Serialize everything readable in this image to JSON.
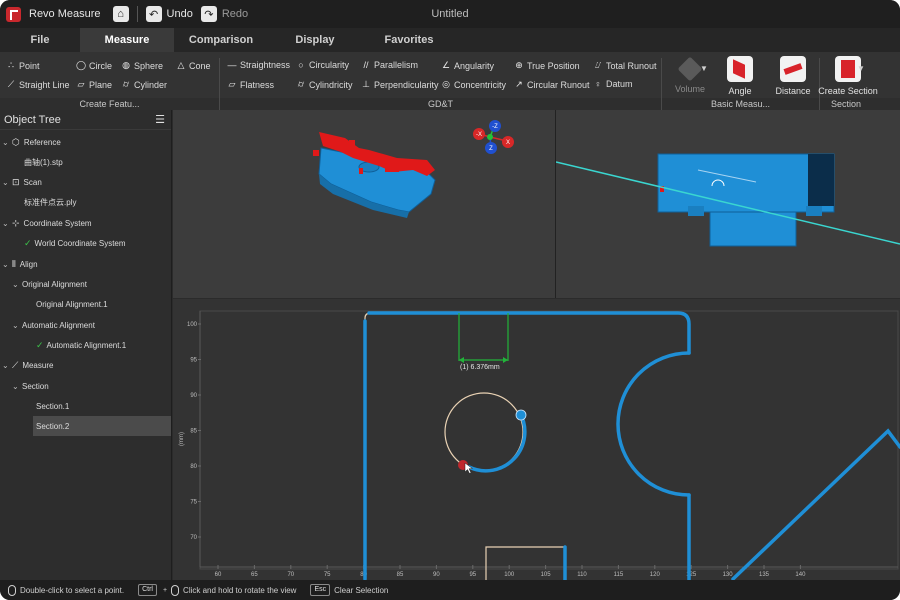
{
  "app": {
    "name": "Revo Measure",
    "document_title": "Untitled",
    "undo_label": "Undo",
    "redo_label": "Redo"
  },
  "menu_tabs": [
    {
      "label": "File"
    },
    {
      "label": "Measure"
    },
    {
      "label": "Comparison"
    },
    {
      "label": "Display"
    },
    {
      "label": "Favorites"
    }
  ],
  "ribbon": {
    "create_feature": [
      "Point",
      "Circle",
      "Sphere",
      "Cone",
      "Straight Line",
      "Plane",
      "Cylinder"
    ],
    "gdt": [
      "Straightness",
      "Circularity",
      "Parallelism",
      "Angularity",
      "True Position",
      "Total Runout",
      "Flatness",
      "Cylindricity",
      "Perpendicularity",
      "Concentricity",
      "Circular Runout",
      "Datum"
    ],
    "basic": [
      "Volume",
      "Angle",
      "Distance"
    ],
    "section": [
      "Create Section"
    ],
    "groups": [
      "Create Featu...",
      "GD&T",
      "Basic Measu...",
      "Section"
    ]
  },
  "object_tree": {
    "title": "Object Tree",
    "items": [
      {
        "label": "Reference"
      },
      {
        "label": "曲轴(1).stp"
      },
      {
        "label": "Scan"
      },
      {
        "label": "标准件点云.ply"
      },
      {
        "label": "Coordinate System"
      },
      {
        "label": "World Coordinate System"
      },
      {
        "label": "Align"
      },
      {
        "label": "Original Alignment"
      },
      {
        "label": "Original Alignment.1"
      },
      {
        "label": "Automatic Alignment"
      },
      {
        "label": "Automatic Alignment.1"
      },
      {
        "label": "Measure"
      },
      {
        "label": "Section"
      },
      {
        "label": "Section.1"
      },
      {
        "label": "Section.2"
      }
    ]
  },
  "axis_gizmo": {
    "z_neg": "-Z",
    "x_neg": "-X",
    "x": "X",
    "z": "Z"
  },
  "section_view": {
    "ylabel": "(mm)",
    "measurement_label": "(1) 6.376mm",
    "y_ticks": [
      "100",
      "95",
      "90",
      "85",
      "80",
      "75",
      "70"
    ],
    "x_ticks": [
      "60",
      "65",
      "70",
      "75",
      "80",
      "85",
      "90",
      "95",
      "100",
      "105",
      "110",
      "115",
      "120",
      "125",
      "130",
      "135",
      "140"
    ]
  },
  "status": {
    "hint1": "Double-click to select a point.",
    "ctrl_key": "Ctrl",
    "hint2": "Click and hold to rotate the view",
    "esc_key": "Esc",
    "hint3": "Clear Selection"
  },
  "colors": {
    "accent_blue": "#1f8fd6",
    "reference_red": "#e01919",
    "cyan_line": "#3ad6d0",
    "measure_green": "#22b33a",
    "profile_beige": "#e9d2b4"
  }
}
